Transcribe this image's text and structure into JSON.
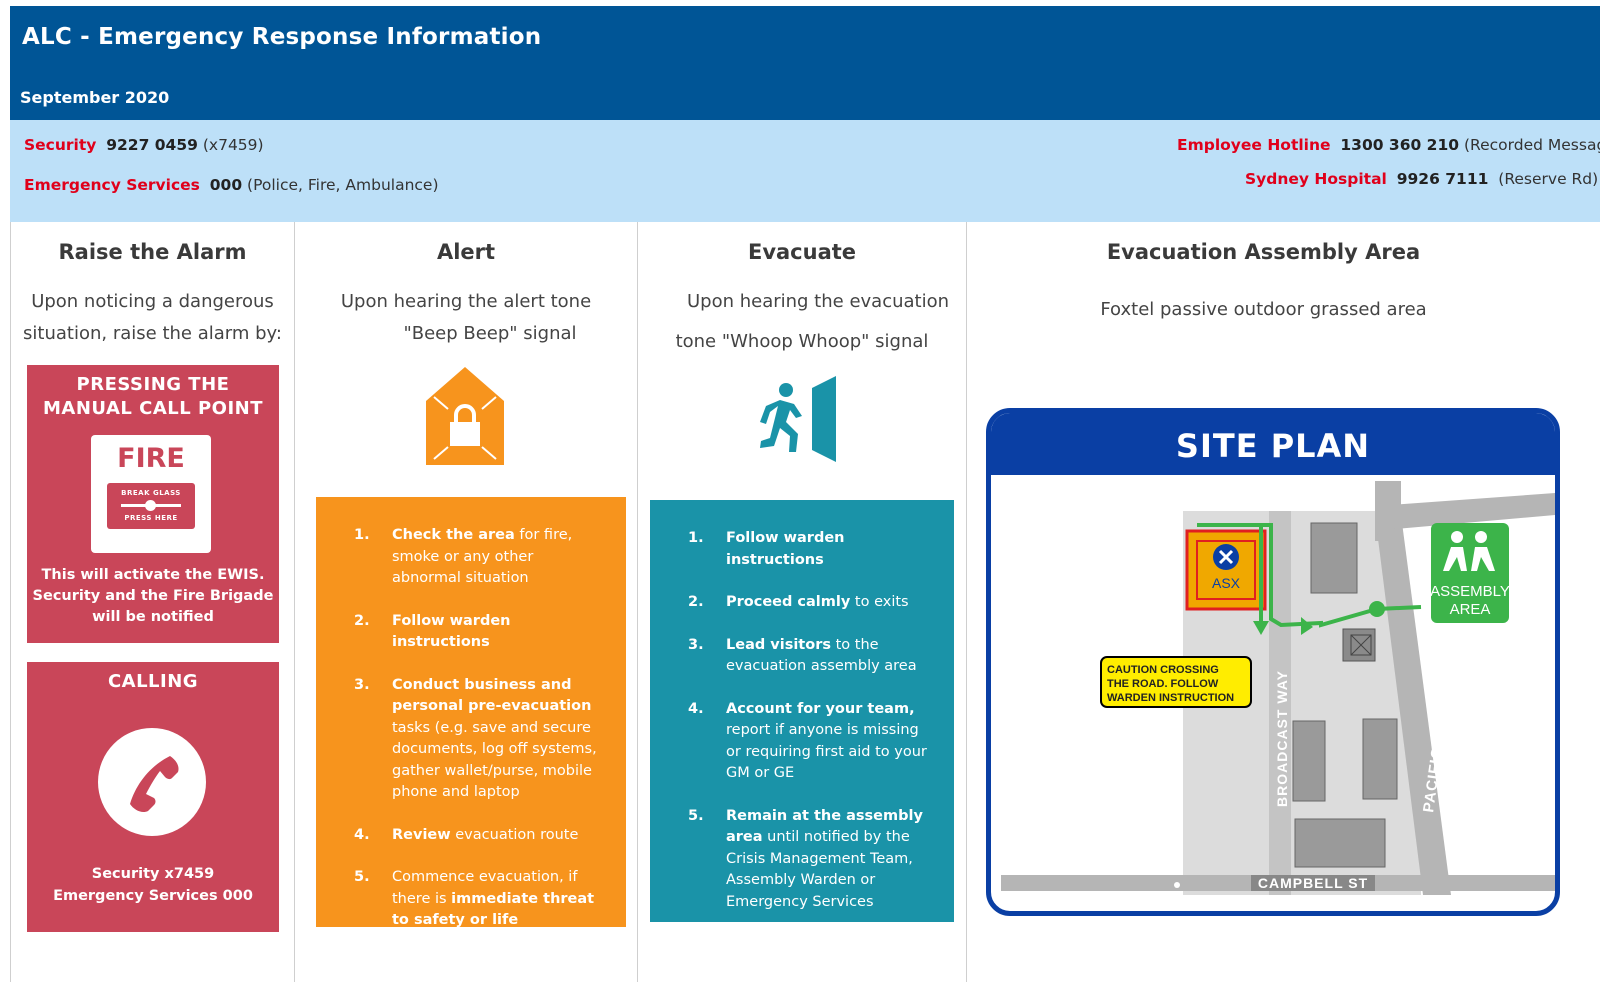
{
  "header": {
    "title": "ALC - Emergency Response Information",
    "date": "September 2020"
  },
  "contacts": {
    "security": {
      "label": "Security",
      "number": "9227 0459",
      "note": "(x7459)"
    },
    "emergency": {
      "label": "Emergency Services",
      "number": "000",
      "note": "(Police, Fire, Ambulance)"
    },
    "hotline": {
      "label": "Employee Hotline",
      "number": "1300 360 210",
      "note": "(Recorded Message"
    },
    "hospital": {
      "label": "Sydney Hospital",
      "number": "9926 7111",
      "note": "(Reserve Rd)"
    }
  },
  "raise": {
    "heading": "Raise the Alarm",
    "text1": "Upon noticing a dangerous",
    "text2": "situation, raise the alarm by:",
    "box1": {
      "cap1": "PRESSING THE",
      "cap2": "MANUAL CALL POINT",
      "fire": "FIRE",
      "glass1": "BREAK GLASS",
      "glass2": "PRESS HERE",
      "foot1": "This will activate the EWIS.",
      "foot2": "Security and the Fire Brigade",
      "foot3": "will be notified"
    },
    "box2": {
      "cap": "CALLING",
      "foot1": "Security x7459",
      "foot2": "Emergency Services 000"
    }
  },
  "alert": {
    "heading": "Alert",
    "text1": "Upon hearing the alert tone",
    "text2": "\"Beep Beep\" signal",
    "items": [
      {
        "n": "1.",
        "b": "Check the area",
        "t": " for fire, smoke or any other abnormal situation"
      },
      {
        "n": "2.",
        "b": "Follow warden instructions",
        "t": ""
      },
      {
        "n": "3.",
        "b": "Conduct business and personal pre-evacuation",
        "t": " tasks (e.g. save and secure documents, log off systems, gather wallet/purse, mobile phone and laptop"
      },
      {
        "n": "4.",
        "b": "Review",
        "t": " evacuation route"
      },
      {
        "n": "5.",
        "pre": "Commence evacuation, if there is ",
        "b": "immediate threat to safety or life",
        "t": ""
      }
    ]
  },
  "evacuate": {
    "heading": "Evacuate",
    "text1": "Upon hearing the evacuation",
    "text2": "tone \"Whoop Whoop\" signal",
    "items": [
      {
        "n": "1.",
        "b": "Follow warden instructions",
        "t": ""
      },
      {
        "n": "2.",
        "b": "Proceed calmly",
        "t": " to exits"
      },
      {
        "n": "3.",
        "b": "Lead visitors",
        "t": " to the evacuation assembly area"
      },
      {
        "n": "4.",
        "b": "Account for your team,",
        "t": " report if anyone is missing or requiring first aid to your GM or GE"
      },
      {
        "n": "5.",
        "b": "Remain at the assembly area",
        "t": " until notified by the Crisis Management Team, Assembly Warden or Emergency Services"
      }
    ]
  },
  "assembly": {
    "heading": "Evacuation Assembly Area",
    "text": "Foxtel passive outdoor grassed area",
    "siteplan": {
      "title": "SITE PLAN",
      "asx": "ASX",
      "assembly1": "ASSEMBLY",
      "assembly2": "AREA",
      "caution1": "CAUTION CROSSING",
      "caution2": "THE ROAD. FOLLOW",
      "caution3": "WARDEN INSTRUCTION",
      "street1": "BROADCAST WAY",
      "street2": "PACIFIC HIGHWAY",
      "street3": "CAMPBELL ST"
    }
  },
  "colors": {
    "header": "#005596",
    "contacts_bg": "#bde0f8",
    "label_red": "#e0001b",
    "raise_red": "#c94659",
    "alert_orange": "#f7941d",
    "evac_teal": "#1a93a8",
    "siteplan_blue": "#0a3fa4",
    "assembly_green": "#3cb44a"
  }
}
